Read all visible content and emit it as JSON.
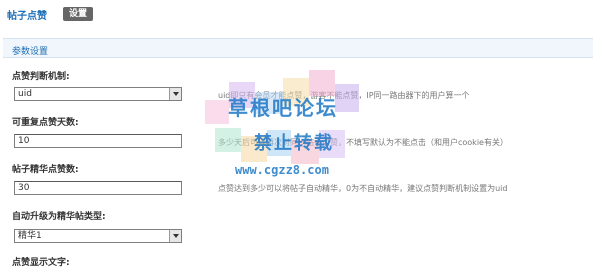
{
  "header": {
    "title": "帖子点赞",
    "tab_label": "设置"
  },
  "section": {
    "title": "参数设置"
  },
  "fields": [
    {
      "label": "点赞判断机制:",
      "value": "uid",
      "desc": "uid即只有会员才能点赞，游客不能点赞，IP同一路由器下的用户算一个"
    },
    {
      "label": "可重复点赞天数:",
      "value": "10",
      "desc": "多少天后可以再次对同一帖子点赞，不填写默认为不能点击（和用户cookie有关）"
    },
    {
      "label": "帖子精华点赞数:",
      "value": "30",
      "desc": "点赞达到多少可以将帖子自动精华，0为不自动精华，建议点赞判断机制设置为uid"
    },
    {
      "label": "自动升级为精华帖类型:",
      "value": "精华1",
      "desc": ""
    },
    {
      "label": "点赞显示文字:",
      "value": "",
      "desc": ""
    }
  ],
  "watermark": {
    "line1": "草根吧论坛",
    "line2": "禁止转载",
    "line3": "www.cgzz8.com"
  },
  "colors": {
    "accent": "#1e6fb5",
    "section_bg": "#f0f6fb",
    "tab_bg": "#666666"
  }
}
